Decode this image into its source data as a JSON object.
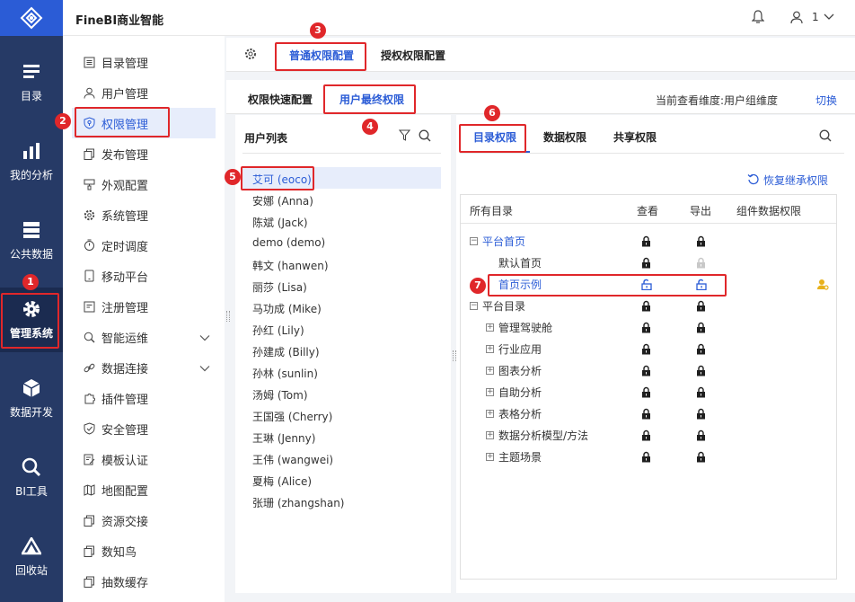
{
  "app": {
    "title": "FineBI商业智能",
    "user": "1"
  },
  "leftnav": [
    {
      "label": "目录",
      "icon": "catalog-icon"
    },
    {
      "label": "我的分析",
      "icon": "analysis-icon"
    },
    {
      "label": "公共数据",
      "icon": "public-data-icon"
    },
    {
      "label": "管理系统",
      "icon": "gear-icon"
    },
    {
      "label": "数据开发",
      "icon": "cube-icon"
    },
    {
      "label": "BI工具",
      "icon": "tools-icon"
    },
    {
      "label": "回收站",
      "icon": "recycle-bin-icon"
    }
  ],
  "sidebar": [
    {
      "label": "目录管理",
      "icon": "list-icon"
    },
    {
      "label": "用户管理",
      "icon": "user-icon"
    },
    {
      "label": "权限管理",
      "icon": "shield-icon"
    },
    {
      "label": "发布管理",
      "icon": "copy-icon"
    },
    {
      "label": "外观配置",
      "icon": "paint-icon"
    },
    {
      "label": "系统管理",
      "icon": "gear-icon"
    },
    {
      "label": "定时调度",
      "icon": "timer-icon"
    },
    {
      "label": "移动平台",
      "icon": "phone-icon"
    },
    {
      "label": "注册管理",
      "icon": "register-icon"
    },
    {
      "label": "智能运维",
      "icon": "search-gear-icon"
    },
    {
      "label": "数据连接",
      "icon": "link-icon"
    },
    {
      "label": "插件管理",
      "icon": "puzzle-icon"
    },
    {
      "label": "安全管理",
      "icon": "shield-check-icon"
    },
    {
      "label": "模板认证",
      "icon": "edit-doc-icon"
    },
    {
      "label": "地图配置",
      "icon": "map-icon"
    },
    {
      "label": "资源交接",
      "icon": "copy-icon"
    },
    {
      "label": "数知鸟",
      "icon": "copy-icon"
    },
    {
      "label": "抽数缓存",
      "icon": "copy-icon"
    }
  ],
  "tabs1": [
    "普通权限配置",
    "授权权限配置"
  ],
  "tabs2": [
    "权限快速配置",
    "用户最终权限"
  ],
  "dimension": {
    "label": "当前查看维度:用户组维度",
    "switch": "切换"
  },
  "userlist": {
    "title": "用户列表",
    "users": [
      "艾可 (eoco)",
      "安娜 (Anna)",
      "陈斌 (Jack)",
      "demo (demo)",
      "韩文 (hanwen)",
      "丽莎 (Lisa)",
      "马功成 (Mike)",
      "孙红 (Lily)",
      "孙建成 (Billy)",
      "孙林 (sunlin)",
      "汤姆 (Tom)",
      "王国强 (Cherry)",
      "王琳 (Jenny)",
      "王伟 (wangwei)",
      "夏梅 (Alice)",
      "张珊 (zhangshan)"
    ]
  },
  "permtabs": [
    "目录权限",
    "数据权限",
    "共享权限"
  ],
  "restore": "恢复继承权限",
  "table": {
    "headers": [
      "所有目录",
      "查看",
      "导出",
      "组件数据权限"
    ],
    "rows": [
      {
        "name": "平台首页",
        "indent": 0,
        "expander": "minus",
        "view": "lock-closed",
        "export": "lock-closed",
        "blue": true
      },
      {
        "name": "默认首页",
        "indent": 1,
        "expander": "",
        "view": "lock-closed",
        "export": "lock-disabled",
        "blue": false
      },
      {
        "name": "首页示例",
        "indent": 1,
        "expander": "",
        "view": "lock-open",
        "export": "lock-open",
        "blue": true,
        "component": "user-key-icon"
      },
      {
        "name": "平台目录",
        "indent": 0,
        "expander": "minus",
        "view": "lock-closed",
        "export": "lock-closed",
        "blue": false
      },
      {
        "name": "管理驾驶舱",
        "indent": 1,
        "expander": "plus",
        "view": "lock-closed",
        "export": "lock-closed",
        "blue": false
      },
      {
        "name": "行业应用",
        "indent": 1,
        "expander": "plus",
        "view": "lock-closed",
        "export": "lock-closed",
        "blue": false
      },
      {
        "name": "图表分析",
        "indent": 1,
        "expander": "plus",
        "view": "lock-closed",
        "export": "lock-closed",
        "blue": false
      },
      {
        "name": "自助分析",
        "indent": 1,
        "expander": "plus",
        "view": "lock-closed",
        "export": "lock-closed",
        "blue": false
      },
      {
        "name": "表格分析",
        "indent": 1,
        "expander": "plus",
        "view": "lock-closed",
        "export": "lock-closed",
        "blue": false
      },
      {
        "name": "数据分析模型/方法",
        "indent": 1,
        "expander": "plus",
        "view": "lock-closed",
        "export": "lock-closed",
        "blue": false
      },
      {
        "name": "主题场景",
        "indent": 1,
        "expander": "plus",
        "view": "lock-closed",
        "export": "lock-closed",
        "blue": false
      }
    ]
  },
  "markers": [
    "1",
    "2",
    "3",
    "4",
    "5",
    "6",
    "7"
  ],
  "colors": {
    "accent": "#2b5cd6",
    "nav": "#263a66",
    "marker": "#e0272a",
    "lock": "#1f1f1f",
    "lock_open": "#2b5cd6"
  }
}
